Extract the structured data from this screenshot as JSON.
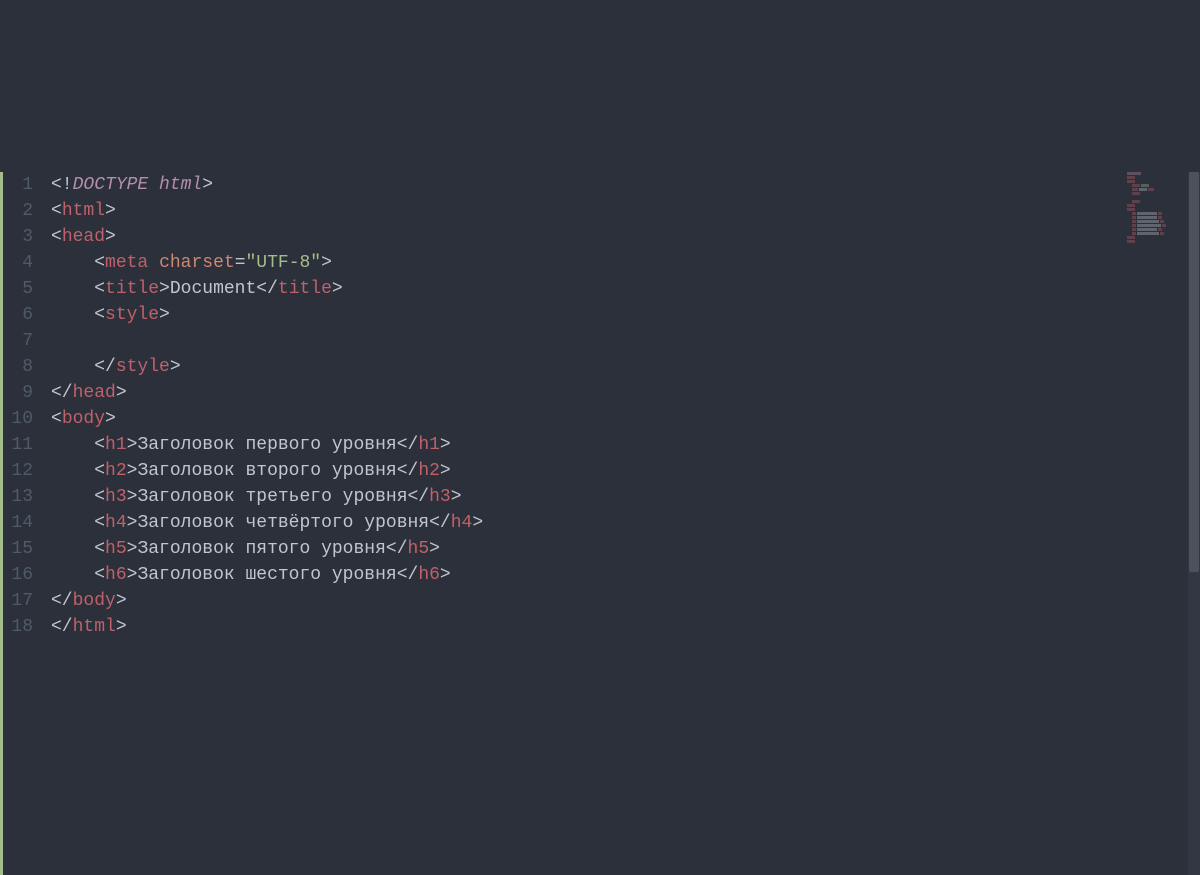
{
  "editor": {
    "lines": [
      {
        "num": "1",
        "tokens": [
          {
            "cls": "doctype-punct",
            "t": "<!"
          },
          {
            "cls": "doctype-kw",
            "t": "DOCTYPE html"
          },
          {
            "cls": "doctype-punct",
            "t": ">"
          }
        ]
      },
      {
        "num": "2",
        "tokens": [
          {
            "cls": "punct",
            "t": "<"
          },
          {
            "cls": "tag",
            "t": "html"
          },
          {
            "cls": "punct",
            "t": ">"
          }
        ]
      },
      {
        "num": "3",
        "tokens": [
          {
            "cls": "punct",
            "t": "<"
          },
          {
            "cls": "tag",
            "t": "head"
          },
          {
            "cls": "punct",
            "t": ">"
          }
        ]
      },
      {
        "num": "4",
        "tokens": [
          {
            "cls": "text",
            "t": "    "
          },
          {
            "cls": "punct",
            "t": "<"
          },
          {
            "cls": "tag",
            "t": "meta"
          },
          {
            "cls": "text",
            "t": " "
          },
          {
            "cls": "attr",
            "t": "charset"
          },
          {
            "cls": "punct",
            "t": "="
          },
          {
            "cls": "string",
            "t": "\"UTF-8\""
          },
          {
            "cls": "punct",
            "t": ">"
          }
        ]
      },
      {
        "num": "5",
        "tokens": [
          {
            "cls": "text",
            "t": "    "
          },
          {
            "cls": "punct",
            "t": "<"
          },
          {
            "cls": "tag",
            "t": "title"
          },
          {
            "cls": "punct",
            "t": ">"
          },
          {
            "cls": "text",
            "t": "Document"
          },
          {
            "cls": "punct",
            "t": "</"
          },
          {
            "cls": "tag",
            "t": "title"
          },
          {
            "cls": "punct",
            "t": ">"
          }
        ]
      },
      {
        "num": "6",
        "tokens": [
          {
            "cls": "text",
            "t": "    "
          },
          {
            "cls": "punct",
            "t": "<"
          },
          {
            "cls": "tag",
            "t": "style"
          },
          {
            "cls": "punct",
            "t": ">"
          }
        ]
      },
      {
        "num": "7",
        "tokens": []
      },
      {
        "num": "8",
        "tokens": [
          {
            "cls": "text",
            "t": "    "
          },
          {
            "cls": "punct",
            "t": "</"
          },
          {
            "cls": "tag",
            "t": "style"
          },
          {
            "cls": "punct",
            "t": ">"
          }
        ]
      },
      {
        "num": "9",
        "tokens": [
          {
            "cls": "punct",
            "t": "</"
          },
          {
            "cls": "tag",
            "t": "head"
          },
          {
            "cls": "punct",
            "t": ">"
          }
        ]
      },
      {
        "num": "10",
        "tokens": [
          {
            "cls": "punct",
            "t": "<"
          },
          {
            "cls": "tag",
            "t": "body"
          },
          {
            "cls": "punct",
            "t": ">"
          }
        ]
      },
      {
        "num": "11",
        "tokens": [
          {
            "cls": "text",
            "t": "    "
          },
          {
            "cls": "punct",
            "t": "<"
          },
          {
            "cls": "tag",
            "t": "h1"
          },
          {
            "cls": "punct",
            "t": ">"
          },
          {
            "cls": "text",
            "t": "Заголовок первого уровня"
          },
          {
            "cls": "punct",
            "t": "</"
          },
          {
            "cls": "tag",
            "t": "h1"
          },
          {
            "cls": "punct",
            "t": ">"
          }
        ]
      },
      {
        "num": "12",
        "tokens": [
          {
            "cls": "text",
            "t": "    "
          },
          {
            "cls": "punct",
            "t": "<"
          },
          {
            "cls": "tag",
            "t": "h2"
          },
          {
            "cls": "punct",
            "t": ">"
          },
          {
            "cls": "text",
            "t": "Заголовок второго уровня"
          },
          {
            "cls": "punct",
            "t": "</"
          },
          {
            "cls": "tag",
            "t": "h2"
          },
          {
            "cls": "punct",
            "t": ">"
          }
        ]
      },
      {
        "num": "13",
        "tokens": [
          {
            "cls": "text",
            "t": "    "
          },
          {
            "cls": "punct",
            "t": "<"
          },
          {
            "cls": "tag",
            "t": "h3"
          },
          {
            "cls": "punct",
            "t": ">"
          },
          {
            "cls": "text",
            "t": "Заголовок третьего уровня"
          },
          {
            "cls": "punct",
            "t": "</"
          },
          {
            "cls": "tag",
            "t": "h3"
          },
          {
            "cls": "punct",
            "t": ">"
          }
        ]
      },
      {
        "num": "14",
        "tokens": [
          {
            "cls": "text",
            "t": "    "
          },
          {
            "cls": "punct",
            "t": "<"
          },
          {
            "cls": "tag",
            "t": "h4"
          },
          {
            "cls": "punct",
            "t": ">"
          },
          {
            "cls": "text",
            "t": "Заголовок четвёртого уровня"
          },
          {
            "cls": "punct",
            "t": "</"
          },
          {
            "cls": "tag",
            "t": "h4"
          },
          {
            "cls": "punct",
            "t": ">"
          }
        ]
      },
      {
        "num": "15",
        "tokens": [
          {
            "cls": "text",
            "t": "    "
          },
          {
            "cls": "punct",
            "t": "<"
          },
          {
            "cls": "tag",
            "t": "h5"
          },
          {
            "cls": "punct",
            "t": ">"
          },
          {
            "cls": "text",
            "t": "Заголовок пятого уровня"
          },
          {
            "cls": "punct",
            "t": "</"
          },
          {
            "cls": "tag",
            "t": "h5"
          },
          {
            "cls": "punct",
            "t": ">"
          }
        ]
      },
      {
        "num": "16",
        "tokens": [
          {
            "cls": "text",
            "t": "    "
          },
          {
            "cls": "punct",
            "t": "<"
          },
          {
            "cls": "tag",
            "t": "h6"
          },
          {
            "cls": "punct",
            "t": ">"
          },
          {
            "cls": "text",
            "t": "Заголовок шестого уровня"
          },
          {
            "cls": "punct",
            "t": "</"
          },
          {
            "cls": "tag",
            "t": "h6"
          },
          {
            "cls": "punct",
            "t": ">"
          }
        ]
      },
      {
        "num": "17",
        "tokens": [
          {
            "cls": "punct",
            "t": "</"
          },
          {
            "cls": "tag",
            "t": "body"
          },
          {
            "cls": "punct",
            "t": ">"
          }
        ]
      },
      {
        "num": "18",
        "tokens": [
          {
            "cls": "punct",
            "t": "</"
          },
          {
            "cls": "tag",
            "t": "html"
          },
          {
            "cls": "punct",
            "t": ">"
          }
        ]
      }
    ]
  }
}
